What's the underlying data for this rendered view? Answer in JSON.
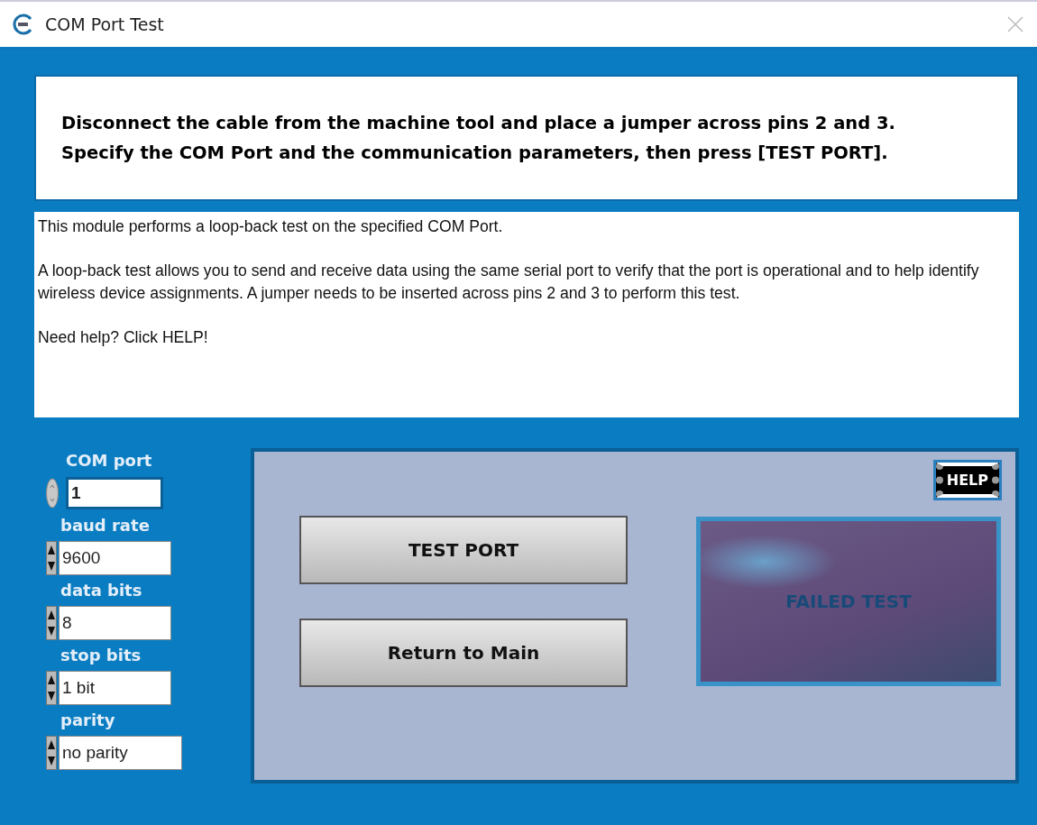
{
  "window": {
    "title": "COM Port Test"
  },
  "instruction": [
    "Disconnect the cable from the machine tool and place a jumper across pins 2 and 3.",
    "Specify the COM Port and the communication parameters, then press [TEST PORT]."
  ],
  "description": [
    "This module performs a loop-back test on the specified COM Port.",
    "A loop-back test allows you to send and receive data using the same serial port to verify that the port is operational and to help identify wireless device assignments.  A jumper needs to be inserted across pins 2 and 3 to perform this test.",
    "Need help? Click HELP!"
  ],
  "parameters": [
    {
      "label": "COM port",
      "value": "1",
      "kind": "knob"
    },
    {
      "label": "baud rate",
      "value": "9600",
      "kind": "arrows"
    },
    {
      "label": "data bits",
      "value": "8",
      "kind": "arrows"
    },
    {
      "label": "stop bits",
      "value": "1 bit",
      "kind": "arrows"
    },
    {
      "label": "parity",
      "value": "no parity",
      "kind": "arrows"
    }
  ],
  "help_button": "HELP",
  "buttons": [
    "TEST PORT",
    "Return to Main"
  ],
  "indicator": {
    "label": "FAILED TEST",
    "lit": false
  }
}
